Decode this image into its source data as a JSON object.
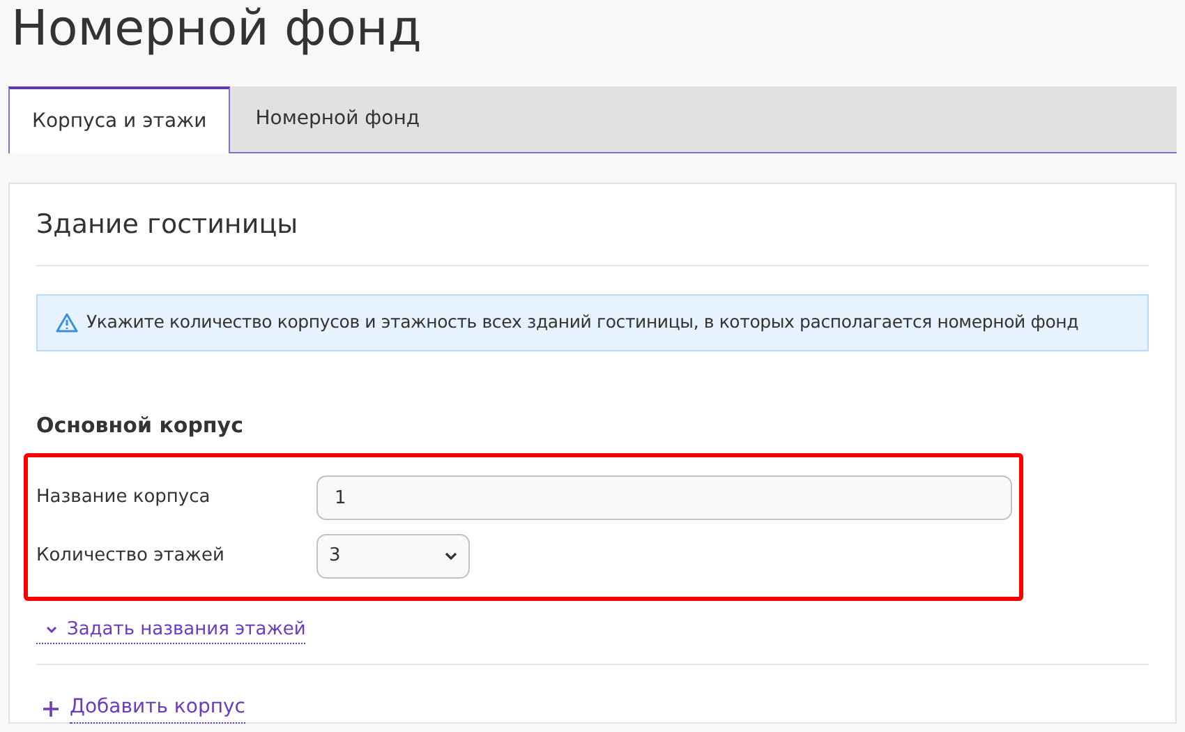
{
  "page_title": "Номерной фонд",
  "tabs": [
    {
      "label": "Корпуса и этажи",
      "selected": true
    },
    {
      "label": "Номерной фонд",
      "selected": false
    }
  ],
  "card": {
    "title": "Здание гостиницы",
    "alert": {
      "kind": "warning",
      "text": "Укажите количество корпусов и этажность всех зданий гостиницы, в которых располагается номерной фонд"
    },
    "building": {
      "title": "Основной корпус",
      "highlighted": true,
      "fields": [
        {
          "kind": "text",
          "label": "Название корпуса",
          "value": "1"
        },
        {
          "kind": "select",
          "label": "Количество этажей",
          "value": "3"
        }
      ],
      "floors_link": "Задать названия этажей"
    },
    "add_link": "Добавить корпус"
  }
}
